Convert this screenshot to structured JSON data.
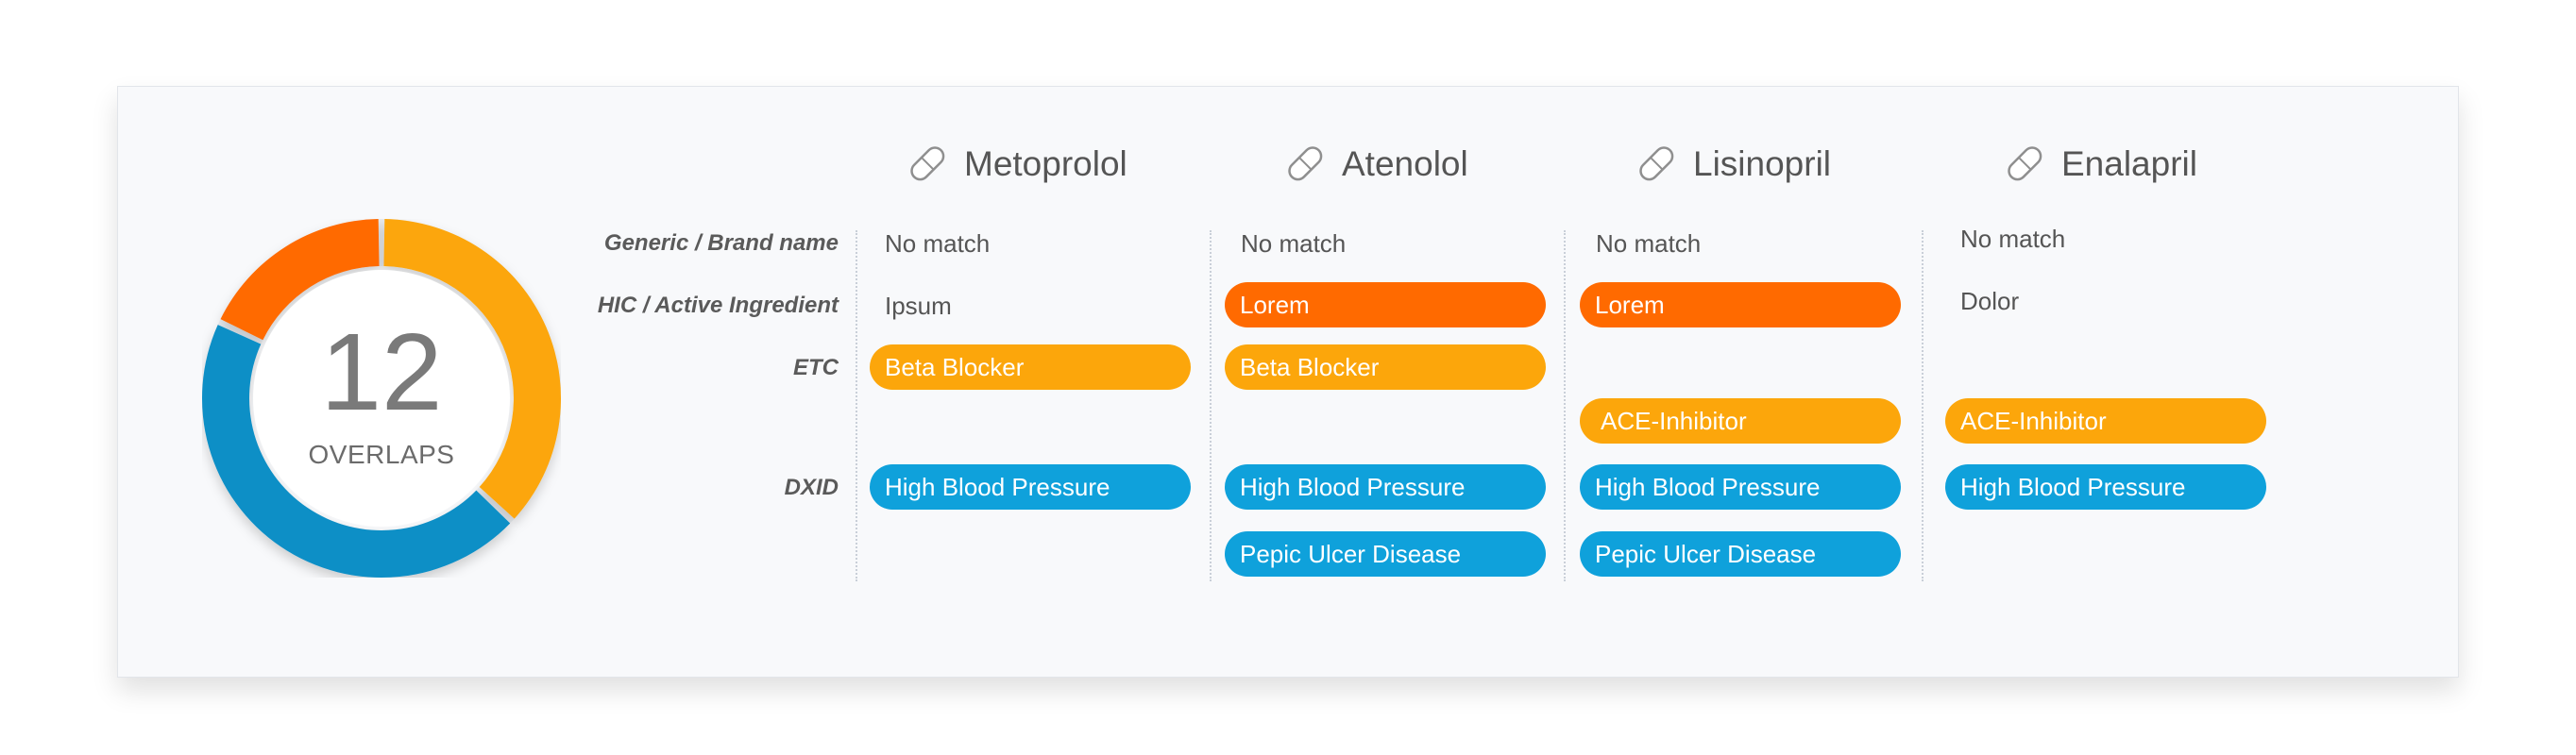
{
  "summary": {
    "count": "12",
    "label": "OVERLAPS",
    "segments": [
      {
        "name": "amber",
        "color": "#fca60b",
        "fraction": 0.37
      },
      {
        "name": "blue",
        "color": "#0f8fc6",
        "fraction": 0.45
      },
      {
        "name": "orange",
        "color": "#ff6a00",
        "fraction": 0.18
      }
    ]
  },
  "row_labels": {
    "generic": "Generic / Brand name",
    "hic": "HIC / Active Ingredient",
    "etc": "ETC",
    "dxid": "DXID"
  },
  "colors": {
    "orange": "#ff6a00",
    "amber": "#fca60b",
    "blue": "#0fa1db"
  },
  "drugs": [
    {
      "name": "Metoprolol",
      "icon": "pill-icon",
      "generic": "No match",
      "hic": "Ipsum",
      "etc": "Beta Blocker",
      "dxid": [
        "High Blood Pressure"
      ]
    },
    {
      "name": "Atenolol",
      "icon": "pill-icon",
      "generic": "No match",
      "hic": "Lorem",
      "etc": "Beta Blocker",
      "dxid": [
        "High Blood Pressure",
        "Pepic Ulcer Disease"
      ]
    },
    {
      "name": "Lisinopril",
      "icon": "pill-icon",
      "generic": "No match",
      "hic": "Lorem",
      "etc": "ACE-Inhibitor",
      "dxid": [
        "High Blood Pressure",
        "Pepic Ulcer Disease"
      ]
    },
    {
      "name": "Enalapril",
      "icon": "pill-icon",
      "generic": "No match",
      "hic": "Dolor",
      "etc": "ACE-Inhibitor",
      "dxid": [
        "High Blood Pressure"
      ]
    }
  ]
}
